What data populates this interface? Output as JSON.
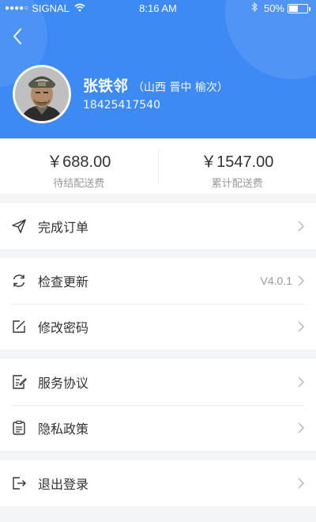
{
  "status_bar": {
    "signal_dots": "●●●●○",
    "carrier": "SIGNAL",
    "time": "8:16 AM",
    "battery_pct": "50%",
    "battery_level": 0.5
  },
  "profile": {
    "name": "张铁邻",
    "location": "（山西  晋中  榆次）",
    "phone": "18425417540"
  },
  "stats": {
    "pending": {
      "value": "￥688.00",
      "label": "待结配送费"
    },
    "total": {
      "value": "￥1547.00",
      "label": "累计配送费"
    }
  },
  "menu": {
    "completed_orders": {
      "label": "完成订单",
      "icon": "paper-plane-icon"
    },
    "check_update": {
      "label": "检查更新",
      "value": "V4.0.1",
      "icon": "refresh-icon"
    },
    "change_password": {
      "label": "修改密码",
      "icon": "edit-icon"
    },
    "service_agreement": {
      "label": "服务协议",
      "icon": "document-edit-icon"
    },
    "privacy_policy": {
      "label": "隐私政策",
      "icon": "clipboard-icon"
    },
    "logout": {
      "label": "退出登录",
      "icon": "logout-icon"
    }
  },
  "colors": {
    "header_bg": "#3d8af5",
    "page_bg": "#f4f5f7",
    "text_primary": "#333333",
    "text_secondary": "#999999"
  }
}
